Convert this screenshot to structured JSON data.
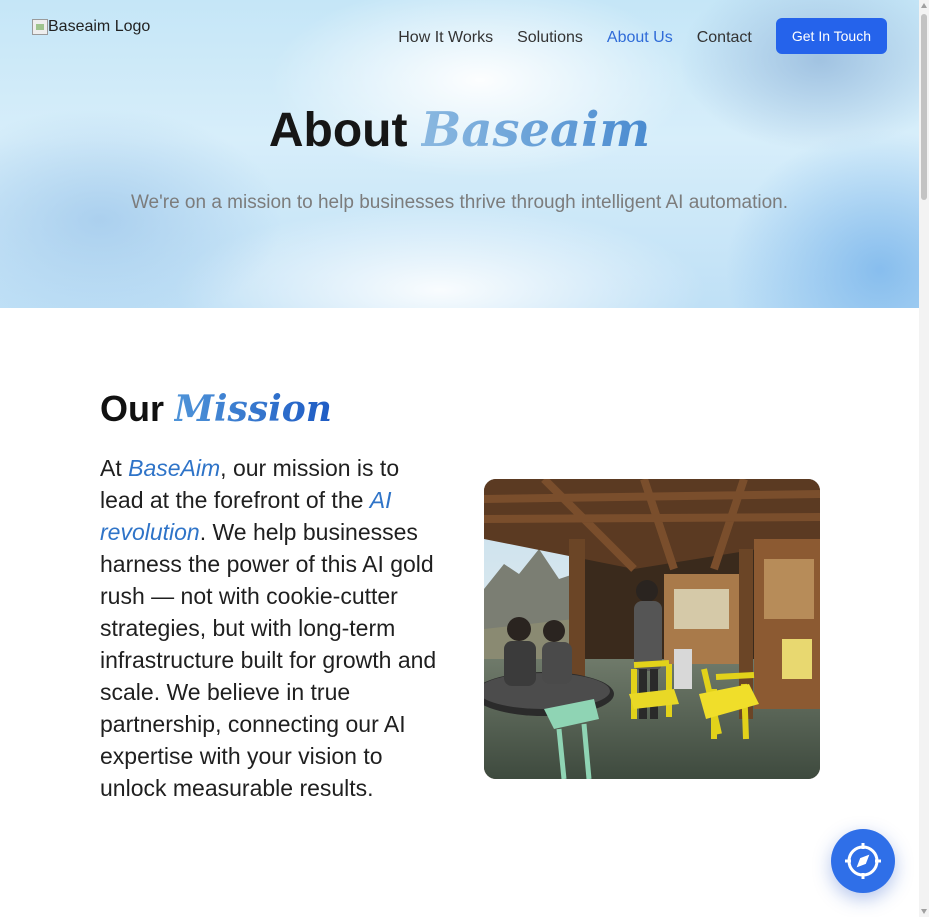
{
  "header": {
    "logo_alt": "Baseaim Logo",
    "nav": [
      {
        "label": "How It Works",
        "active": false
      },
      {
        "label": "Solutions",
        "active": false
      },
      {
        "label": "About Us",
        "active": true
      },
      {
        "label": "Contact",
        "active": false
      }
    ],
    "cta_label": "Get In Touch"
  },
  "hero": {
    "title_plain": "About",
    "title_accent": "Baseaim",
    "subtitle": "We're on a mission to help businesses thrive through intelligent AI automation."
  },
  "mission": {
    "title_plain": "Our",
    "title_accent": "Mission",
    "text_1": "At ",
    "text_hl_1": "BaseAim",
    "text_2": ", our mission is to lead at the forefront of the ",
    "text_hl_2": "AI revolution",
    "text_3": ". We help businesses harness the power of this AI gold rush — not with cookie-cutter strategies, but with long-term infrastructure built for growth and scale. We believe in true partnership, connecting our AI expertise with your vision to unlock measurable results."
  },
  "icons": {
    "fab": "compass-icon",
    "logo": "broken-image-icon"
  },
  "colors": {
    "accent": "#2563eb",
    "nav_active": "#2f6bd8",
    "highlight": "#2f74c8"
  }
}
